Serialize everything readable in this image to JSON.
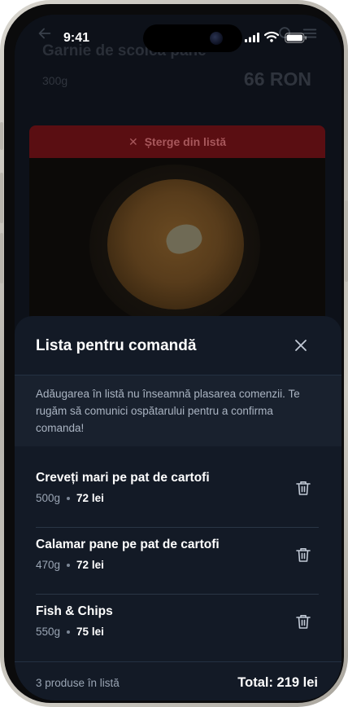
{
  "status_bar": {
    "time": "9:41"
  },
  "background_page": {
    "product_title": "Garnie de scoica pane",
    "product_weight": "300g",
    "product_price": "66 RON",
    "remove_button_label": "Șterge din listă",
    "remove_icon": "x-icon",
    "photo_icon": "food-photo"
  },
  "sheet": {
    "title": "Lista pentru comandă",
    "close_icon": "close-icon",
    "notice": "Adăugarea în listă nu înseamnă plasarea comenzii. Te rugăm să comunici ospătarului pentru a confirma comanda!",
    "items": [
      {
        "name": "Creveți mari pe pat de cartofi",
        "weight": "500g",
        "price": "72 lei"
      },
      {
        "name": "Calamar pane pe pat de cartofi",
        "weight": "470g",
        "price": "72 lei"
      },
      {
        "name": "Fish & Chips",
        "weight": "550g",
        "price": "75 lei"
      }
    ],
    "footer": {
      "count_text": "3 produse în listă",
      "total_text": "Total: 219 lei"
    }
  },
  "colors": {
    "sheet_bg": "#131a26",
    "notice_bg": "#19212e",
    "remove_red": "#5a0e12",
    "text_primary": "#ffffff",
    "text_secondary": "#9aa5b4"
  }
}
